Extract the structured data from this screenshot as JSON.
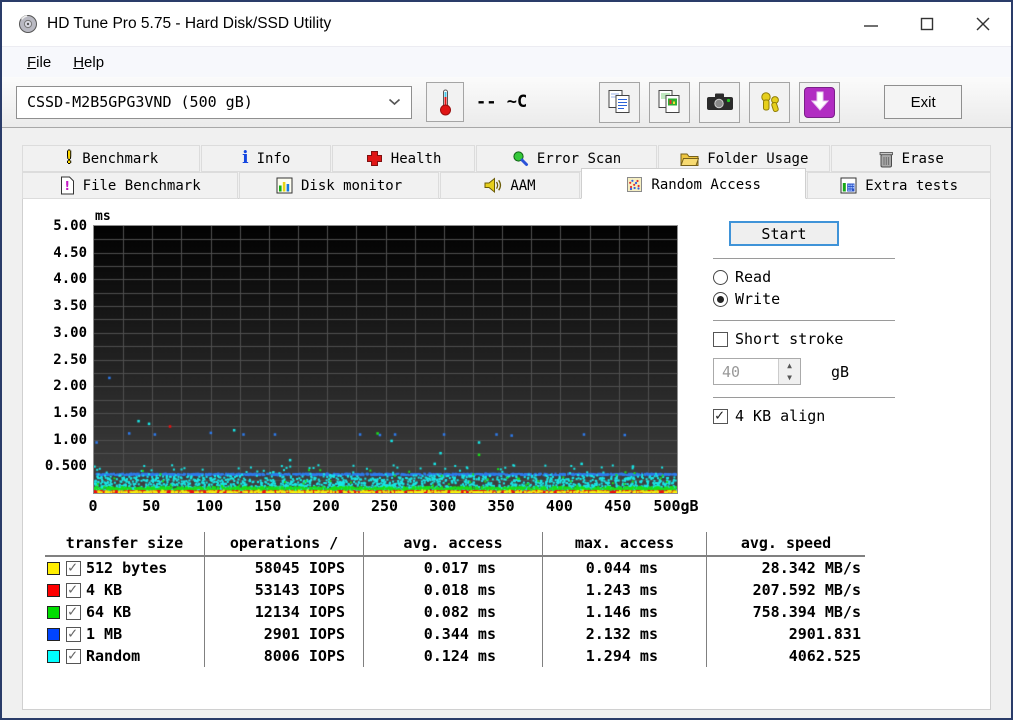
{
  "window": {
    "title": "HD Tune Pro 5.75 - Hard Disk/SSD Utility"
  },
  "menu": {
    "items": [
      {
        "accel": "F",
        "rest": "ile"
      },
      {
        "accel": "H",
        "rest": "elp"
      }
    ]
  },
  "toolbar": {
    "drive": "CSSD-M2B5GPG3VND (500 gB)",
    "temperature": "-- ~C",
    "exit": "Exit"
  },
  "tabs": {
    "row1": [
      {
        "label": "Benchmark"
      },
      {
        "label": "Info"
      },
      {
        "label": "Health"
      },
      {
        "label": "Error Scan"
      },
      {
        "label": "Folder Usage"
      },
      {
        "label": "Erase"
      }
    ],
    "row2": [
      {
        "label": "File Benchmark"
      },
      {
        "label": "Disk monitor"
      },
      {
        "label": "AAM"
      },
      {
        "label": "Random Access",
        "active": true
      },
      {
        "label": "Extra tests"
      }
    ]
  },
  "panel": {
    "start": "Start",
    "read": "Read",
    "read_selected": false,
    "write": "Write",
    "write_selected": true,
    "short_stroke": "Short stroke",
    "short_stroke_checked": false,
    "capacity": "40",
    "capacity_unit": "gB",
    "align": "4 KB align",
    "align_checked": true
  },
  "chart_data": {
    "type": "scatter",
    "title": "Random Access test - access time (ms) vs disk position (gB)",
    "ylabel": "ms",
    "xlabel": "gB",
    "xlim": [
      0,
      500
    ],
    "ylim": [
      0,
      5
    ],
    "x_ticks": [
      0,
      50,
      100,
      150,
      200,
      250,
      300,
      350,
      400,
      450,
      500
    ],
    "x_tick_labels": [
      "0",
      "50",
      "100",
      "150",
      "200",
      "250",
      "300",
      "350",
      "400",
      "450",
      "500gB"
    ],
    "y_ticks": [
      5.0,
      4.5,
      4.0,
      3.5,
      3.0,
      2.5,
      2.0,
      1.5,
      1.0,
      0.5
    ],
    "y_tick_labels": [
      "5.00",
      "4.50",
      "4.00",
      "3.50",
      "3.00",
      "2.50",
      "2.00",
      "1.50",
      "1.00",
      "0.500"
    ],
    "grid": {
      "x_step": 25,
      "y_step": 0.25,
      "color": "#4f4f4f",
      "on": true
    },
    "background_gradient": [
      "#020202",
      "#414141"
    ],
    "legend_position": "table-below",
    "series": [
      {
        "name": "1 MB",
        "color": "#2e7bed",
        "avg_ms": 0.344,
        "max_ms": 2.132,
        "band": [
          0.332,
          0.362
        ],
        "count": 1050,
        "exp": 1,
        "extra": null,
        "outliers": [
          [
            13,
            2.16
          ],
          [
            2,
            0.95
          ],
          [
            30,
            1.12
          ],
          [
            52,
            1.1
          ],
          [
            100,
            1.13
          ],
          [
            128,
            1.1
          ],
          [
            155,
            1.1
          ],
          [
            228,
            1.1
          ],
          [
            245,
            1.09
          ],
          [
            258,
            1.1
          ],
          [
            300,
            1.1
          ],
          [
            345,
            1.1
          ],
          [
            358,
            1.08
          ],
          [
            420,
            1.1
          ],
          [
            455,
            1.09
          ]
        ]
      },
      {
        "name": "Random",
        "color": "#17e8e8",
        "avg_ms": 0.124,
        "max_ms": 1.294,
        "band": [
          0.045,
          0.33
        ],
        "count": 2300,
        "exp": 2.2,
        "extra": [
          0.33,
          0.52,
          70
        ],
        "outliers": [
          [
            38,
            1.35
          ],
          [
            47,
            1.3
          ],
          [
            120,
            1.18
          ],
          [
            168,
            0.62
          ],
          [
            255,
            0.98
          ],
          [
            292,
            0.55
          ],
          [
            297,
            0.75
          ],
          [
            330,
            0.95
          ],
          [
            418,
            0.55
          ],
          [
            462,
            0.5
          ]
        ]
      },
      {
        "name": "64 KB",
        "color": "#1ae01a",
        "avg_ms": 0.082,
        "max_ms": 1.146,
        "band": [
          0.058,
          0.112
        ],
        "count": 950,
        "exp": 1.3,
        "extra": [
          0.112,
          0.45,
          45
        ],
        "outliers": [
          [
            243,
            1.12
          ],
          [
            330,
            0.72
          ]
        ]
      },
      {
        "name": "4 KB",
        "color": "#ee1111",
        "avg_ms": 0.018,
        "max_ms": 1.243,
        "band": [
          0.012,
          0.04
        ],
        "count": 1200,
        "exp": 1.4,
        "extra": null,
        "outliers": [
          [
            65,
            1.25
          ]
        ]
      },
      {
        "name": "512 bytes",
        "color": "#f2ef0c",
        "avg_ms": 0.017,
        "max_ms": 0.044,
        "band": [
          0.008,
          0.032
        ],
        "count": 480,
        "exp": 1.2,
        "extra": [
          0.032,
          0.05,
          25
        ],
        "outliers": []
      }
    ]
  },
  "table": {
    "headers": [
      "transfer size",
      "operations /",
      "avg. access",
      "max. access",
      "avg. speed"
    ],
    "rows": [
      {
        "color": "#ffee00",
        "checked": true,
        "label": "512 bytes",
        "iops": "58045 IOPS",
        "avg": "0.017 ms",
        "max": "0.044 ms",
        "speed": "28.342 MB/s"
      },
      {
        "color": "#ff0000",
        "checked": true,
        "label": "4 KB",
        "iops": "53143 IOPS",
        "avg": "0.018 ms",
        "max": "1.243 ms",
        "speed": "207.592 MB/s"
      },
      {
        "color": "#00dd00",
        "checked": true,
        "label": "64 KB",
        "iops": "12134 IOPS",
        "avg": "0.082 ms",
        "max": "1.146 ms",
        "speed": "758.394 MB/s"
      },
      {
        "color": "#0044ff",
        "checked": true,
        "label": "1 MB",
        "iops": "2901 IOPS",
        "avg": "0.344 ms",
        "max": "2.132 ms",
        "speed": "2901.831"
      },
      {
        "color": "#00ffff",
        "checked": true,
        "label": "Random",
        "iops": "8006 IOPS",
        "avg": "0.124 ms",
        "max": "1.294 ms",
        "speed": "4062.525"
      }
    ]
  }
}
